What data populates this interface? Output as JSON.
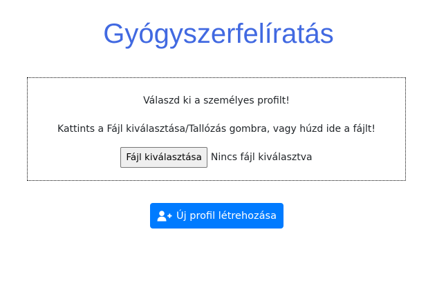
{
  "page": {
    "title": "Gyógyszerfelíratás",
    "title_color": "#4169e1"
  },
  "dropzone": {
    "line1": "Válaszd ki a személyes profilt!",
    "line2": "Kattints a Fájl kiválasztása/Tallózás gombra, vagy húzd ide a fájlt!",
    "file_button_label": "Fájl kiválasztása",
    "file_status": "Nincs fájl kiválasztva"
  },
  "actions": {
    "new_profile_label": "Új profil létrehozása",
    "new_profile_icon": "user-plus-icon",
    "button_color": "#007bff"
  }
}
